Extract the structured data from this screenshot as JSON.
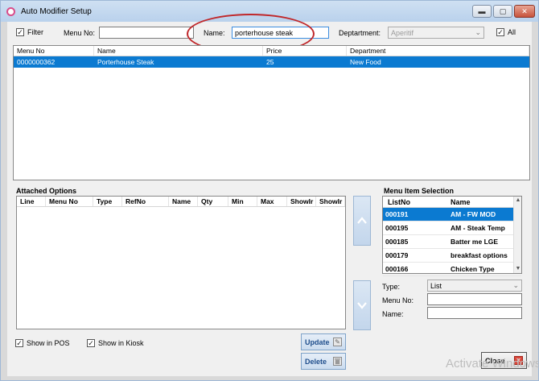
{
  "window": {
    "title": "Auto Modifier Setup",
    "controls": {
      "minimize": "▬",
      "maximize": "▢",
      "close": "✕"
    }
  },
  "filters": {
    "filter_label": "Filter",
    "filter_checked": true,
    "menu_no_label": "Menu No:",
    "menu_no_value": "",
    "name_label": "Name:",
    "name_value": "porterhouse steak",
    "department_label": "Deptartment:",
    "department_value": "Aperitif",
    "all_label": "All",
    "all_checked": true
  },
  "menu_table": {
    "columns": [
      "Menu No",
      "Name",
      "Price",
      "Department"
    ],
    "rows": [
      {
        "menu_no": "0000000362",
        "name": "Porterhouse Steak",
        "price": "25",
        "department": "New Food",
        "selected": true
      }
    ]
  },
  "attached_options": {
    "title": "Attached Options",
    "columns": [
      "Line",
      "Menu No",
      "Type",
      "RefNo",
      "Name",
      "Qty",
      "Min",
      "Max",
      "ShowIr",
      "ShowIr"
    ],
    "rows": []
  },
  "menu_item_selection": {
    "title": "Menu Item Selection",
    "columns": [
      "ListNo",
      "Name"
    ],
    "rows": [
      {
        "list_no": "000191",
        "name": "AM - FW MOD",
        "selected": true
      },
      {
        "list_no": "000195",
        "name": "AM - Steak Temp",
        "selected": false
      },
      {
        "list_no": "000185",
        "name": "Batter me LGE",
        "selected": false
      },
      {
        "list_no": "000179",
        "name": "breakfast options",
        "selected": false
      },
      {
        "list_no": "000166",
        "name": "Chicken Type",
        "selected": false
      }
    ],
    "type_label": "Type:",
    "type_value": "List",
    "menu_no_label": "Menu No:",
    "menu_no_value": "",
    "name_label": "Name:",
    "name_value": ""
  },
  "bottom": {
    "show_in_pos_label": "Show in POS",
    "show_in_pos_checked": true,
    "show_in_kiosk_label": "Show in Kiosk",
    "show_in_kiosk_checked": true,
    "update_label": "Update",
    "delete_label": "Delete",
    "close_label": "Close"
  },
  "watermark": {
    "text": "Activate Windows"
  },
  "icons": {
    "check": "✓",
    "dropdown": "⌄",
    "scroll_up": "▲",
    "scroll_down": "▼",
    "update_icon": "✎",
    "delete_icon": "🗑",
    "close_icon": "✕"
  },
  "colors": {
    "selection": "#0b7ad1",
    "annotation": "#c0282b",
    "button_text": "#1f4e8c"
  }
}
